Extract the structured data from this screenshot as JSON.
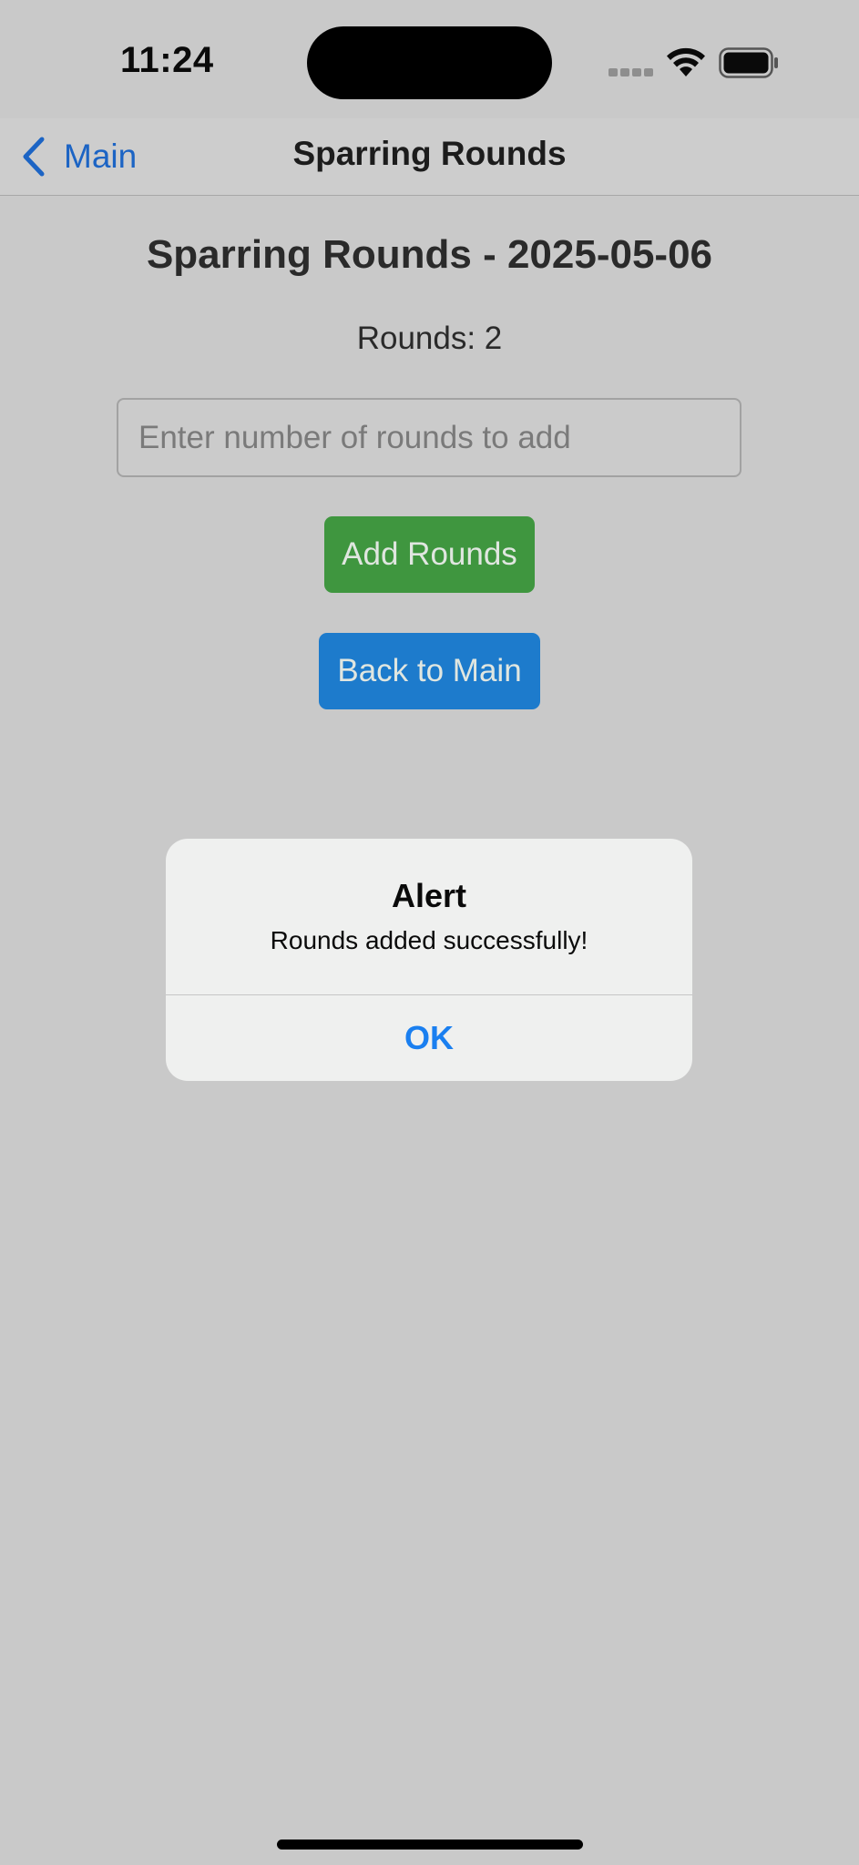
{
  "status_bar": {
    "time": "11:24",
    "icons": [
      "signal-dots-icon",
      "wifi-icon",
      "battery-icon"
    ]
  },
  "nav": {
    "back_label": "Main",
    "back_icon": "chevron-left-icon",
    "title": "Sparring Rounds"
  },
  "page": {
    "heading": "Sparring Rounds - 2025-05-06",
    "rounds_text": "Rounds: 2",
    "input_placeholder": "Enter number of rounds to add",
    "input_value": "",
    "add_button_label": "Add Rounds",
    "back_button_label": "Back to Main"
  },
  "alert": {
    "title": "Alert",
    "message": "Rounds added successfully!",
    "ok_label": "OK"
  },
  "colors": {
    "accent_blue": "#1c64c4",
    "add_button": "#3f963f",
    "back_button": "#1d7bcc",
    "alert_ok": "#1a7ff0",
    "dimmed_background": "#c9c9c9"
  }
}
